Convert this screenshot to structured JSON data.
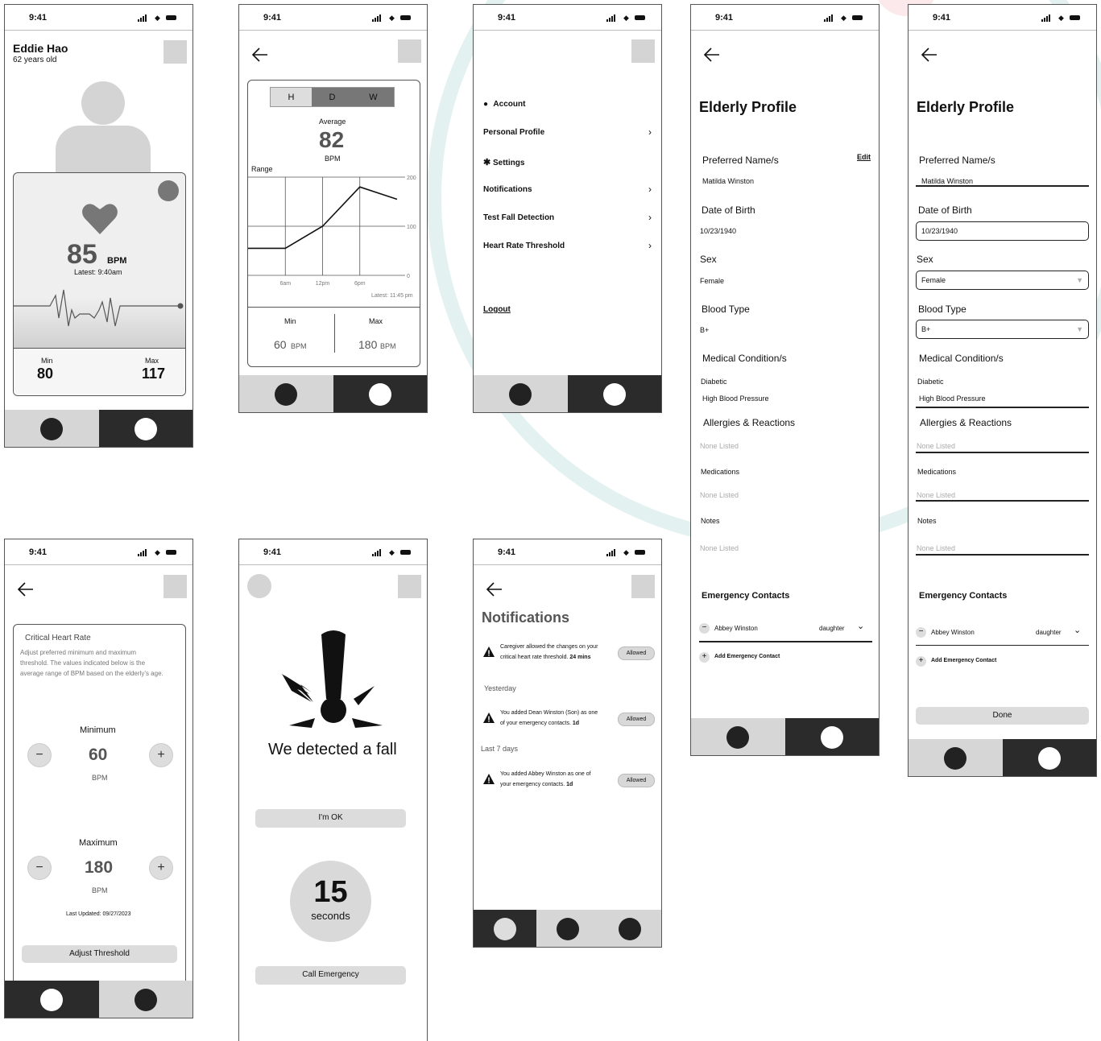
{
  "status_time": "9:41",
  "home": {
    "name": "Eddie Hao",
    "age": "62 years old",
    "bpm_value": "85",
    "bpm_unit": "BPM",
    "latest": "Latest: 9:40am",
    "min_label": "Min",
    "min_value": "80",
    "max_label": "Max",
    "max_value": "117"
  },
  "history": {
    "tabs": [
      "H",
      "D",
      "W"
    ],
    "average_label": "Average",
    "average_value": "82",
    "average_unit": "BPM",
    "range_label": "Range",
    "latest": "Latest: 11:45 pm",
    "min_label": "Min",
    "min_value": "60",
    "max_label": "Max",
    "max_value": "180",
    "bpm_unit": "BPM"
  },
  "chart_data": {
    "type": "line",
    "x": [
      "",
      "6am",
      "12pm",
      "6pm",
      ""
    ],
    "y_ticks": [
      "200",
      "100",
      "0"
    ],
    "series": [
      {
        "values": [
          55,
          55,
          100,
          180,
          155
        ]
      }
    ],
    "ylim": [
      0,
      200
    ]
  },
  "menu": {
    "account": "Account",
    "personal_profile": "Personal Profile",
    "settings": "Settings",
    "notifications": "Notifications",
    "test_fall": "Test Fall Detection",
    "hr_threshold": "Heart Rate Threshold",
    "logout": "Logout"
  },
  "profile": {
    "title": "Elderly Profile",
    "edit": "Edit",
    "preferred_label": "Preferred Name/s",
    "preferred_value": "Matilda Winston",
    "dob_label": "Date of Birth",
    "dob_value": "10/23/1940",
    "sex_label": "Sex",
    "sex_value": "Female",
    "blood_label": "Blood Type",
    "blood_value": "B+",
    "medical_label": "Medical Condition/s",
    "medical_1": "Diabetic",
    "medical_2": "High Blood Pressure",
    "allergies_label": "Allergies & Reactions",
    "none_listed": "None Listed",
    "medications_label": "Medications",
    "notes_label": "Notes",
    "emergency_label": "Emergency Contacts",
    "contact_name": "Abbey Winston",
    "contact_relation": "daughter",
    "add_contact": "Add Emergency Contact",
    "done": "Done"
  },
  "threshold": {
    "title": "Critical Heart Rate",
    "desc_1": "Adjust preferred minimum and maximum",
    "desc_2": "threshold. The values indicated below is the",
    "desc_3": "average range of BPM based on the elderly’s age.",
    "minimum_label": "Minimum",
    "minimum_value": "60",
    "maximum_label": "Maximum",
    "maximum_value": "180",
    "unit": "BPM",
    "updated": "Last Updated: 09/27/2023",
    "adjust_button": "Adjust Threshold"
  },
  "fall": {
    "message": "We detected a fall",
    "ok_button": "I'm OK",
    "countdown_value": "15",
    "countdown_unit": "seconds",
    "call_button": "Call Emergency"
  },
  "notifications": {
    "title": "Notifications",
    "item1_line1": "Caregiver allowed the changes on your",
    "item1_line2": "critical heart rate threshold.",
    "item1_time": "24 mins",
    "yesterday": "Yesterday",
    "item2_line1": "You added Dean Winston (Son) as one",
    "item2_line2": "of your emergency contacts.",
    "item2_time": "1d",
    "last7": "Last 7 days",
    "item3_line1": "You added Abbey Winston as one of",
    "item3_line2": "your emergency contacts.",
    "item3_time": "1d",
    "allowed": "Allowed"
  }
}
